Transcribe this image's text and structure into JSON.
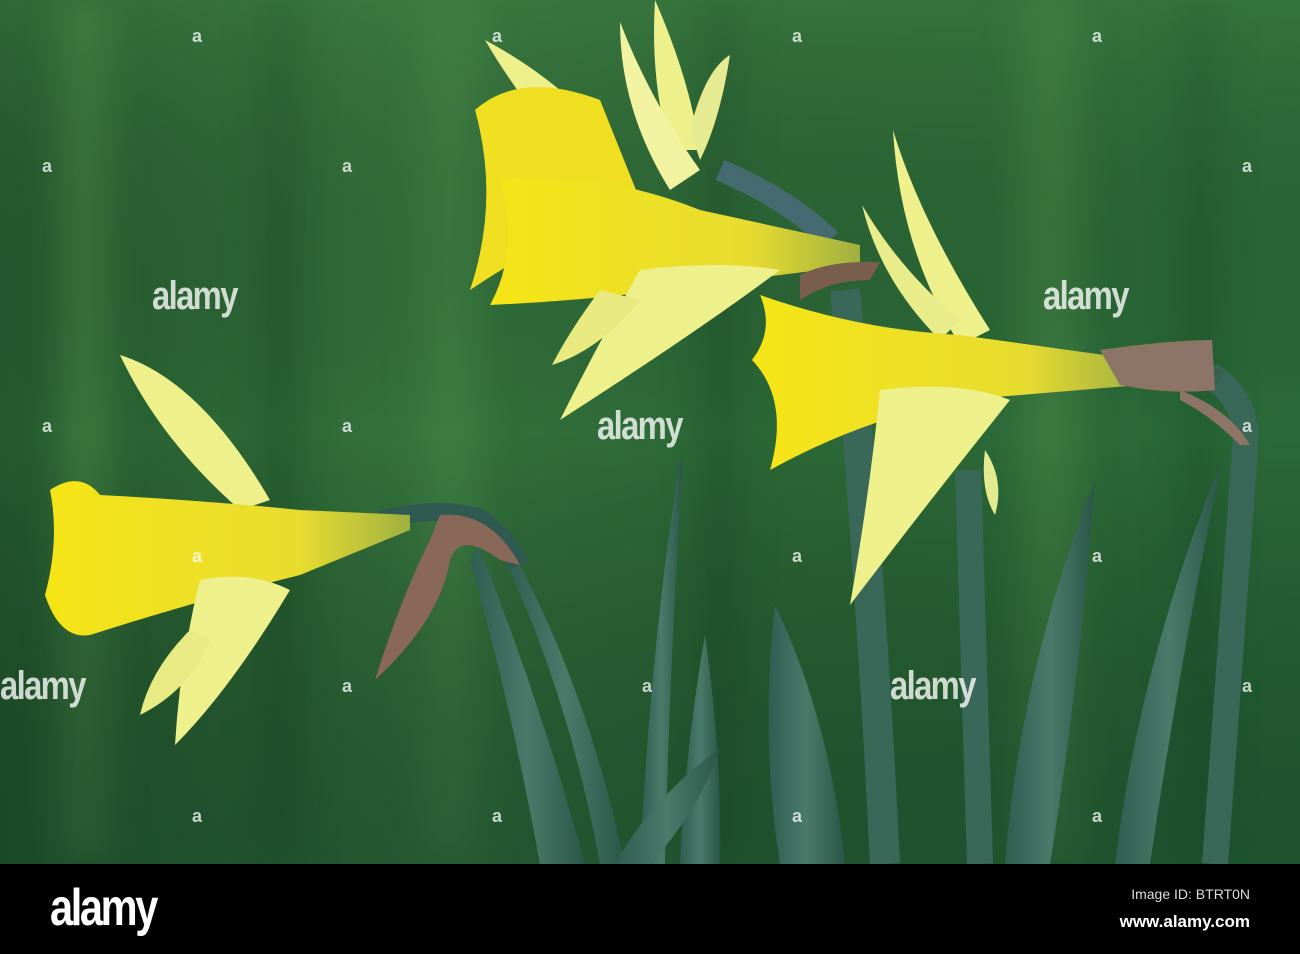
{
  "watermark": {
    "text": "alamy",
    "mark": "a"
  },
  "footer": {
    "logo": "alamy",
    "image_id": "Image ID: BTRT0N",
    "url": "www.alamy.com"
  },
  "colors": {
    "background": "#2f6a3a",
    "trumpet": "#f2e01a",
    "petal": "#eef08c",
    "leaf": "#3c6a5c",
    "bract": "#8a6a58"
  }
}
